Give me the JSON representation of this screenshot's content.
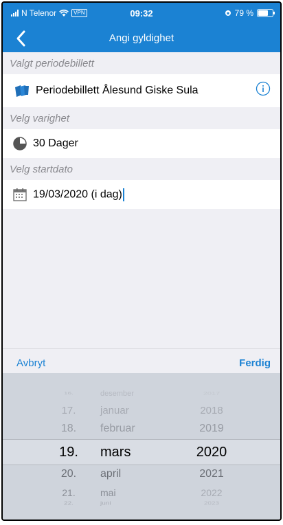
{
  "status": {
    "carrier": "N Telenor",
    "vpn": "VPN",
    "time": "09:32",
    "battery": "79 %",
    "battery_level": 0.79
  },
  "nav": {
    "title": "Angi gyldighet"
  },
  "sections": {
    "ticket_label": "Valgt periodebillett",
    "ticket_value": "Periodebillett Ålesund Giske Sula",
    "duration_label": "Velg varighet",
    "duration_value": "30 Dager",
    "startdate_label": "Velg startdato",
    "startdate_value": "19/03/2020 (i dag)"
  },
  "toolbar": {
    "cancel": "Avbryt",
    "done": "Ferdig"
  },
  "picker": {
    "days": [
      "16.",
      "17.",
      "18.",
      "19.",
      "20.",
      "21.",
      "22."
    ],
    "months": [
      "desember",
      "januar",
      "februar",
      "mars",
      "april",
      "mai",
      "juni"
    ],
    "years": [
      "2017",
      "2018",
      "2019",
      "2020",
      "2021",
      "2022",
      "2023"
    ],
    "selected": {
      "day": "19.",
      "month": "mars",
      "year": "2020"
    }
  },
  "colors": {
    "accent": "#1b82d3",
    "ticket_icon": "#1f6fb8"
  }
}
